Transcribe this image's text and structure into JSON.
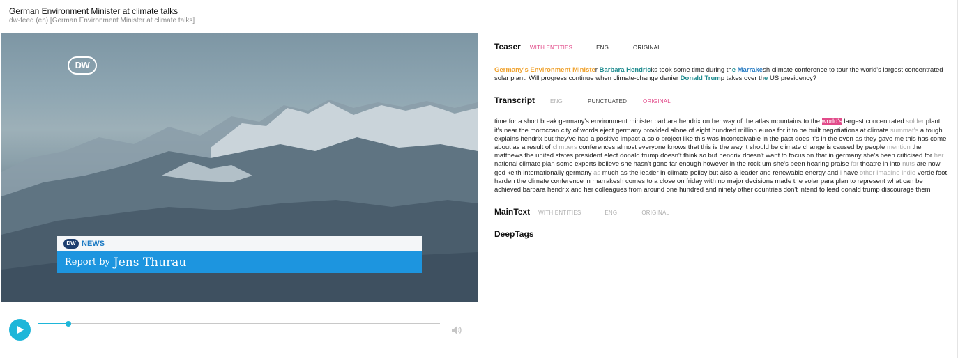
{
  "header": {
    "title": "German Environment Minister at climate talks",
    "subtitle": "dw-feed (en) [German Environment Minister at climate talks]"
  },
  "video": {
    "logo": "DW",
    "lower_third": {
      "badge": "DW",
      "label": "NEWS",
      "prefix": "Report by",
      "name": "Jens Thurau"
    }
  },
  "player": {
    "progress_fraction": 0.075,
    "icons": {
      "play": "play-icon",
      "volume": "volume-icon"
    },
    "accent_color": "#1eb6d9"
  },
  "teaser": {
    "title": "Teaser",
    "tabs": [
      {
        "label": "WITH ENTITIES",
        "active": true
      },
      {
        "label": "ENG",
        "active": false
      },
      {
        "label": "ORIGINAL",
        "active": false
      }
    ],
    "segments": [
      {
        "text": "Germany's Environment Ministe",
        "style": "ent-orange"
      },
      {
        "text": "r ",
        "style": ""
      },
      {
        "text": "Barbara Hendric",
        "style": "ent-teal"
      },
      {
        "text": "ks took some time during th",
        "style": ""
      },
      {
        "text": "e ",
        "style": "ent-teal"
      },
      {
        "text": "Marrake",
        "style": "ent-blue"
      },
      {
        "text": "sh climate conference to tour the world's largest concentrated solar plant. Will progress continue when climate-change denier ",
        "style": ""
      },
      {
        "text": "Donald Trum",
        "style": "ent-teal"
      },
      {
        "text": "p takes over th",
        "style": ""
      },
      {
        "text": "e ",
        "style": "ent-teal"
      },
      {
        "text": "US presidency?",
        "style": ""
      }
    ]
  },
  "transcript": {
    "title": "Transcript",
    "tabs": [
      {
        "label": "ENG",
        "active": false,
        "muted": true
      },
      {
        "label": "PUNCTUATED",
        "active": false,
        "muted": false
      },
      {
        "label": "ORIGINAL",
        "active": true,
        "muted": false
      }
    ],
    "segments": [
      {
        "text": "time for a short break germany's environment minister barbara hendrix on her way of the atlas mountains to the ",
        "style": ""
      },
      {
        "text": "world's",
        "style": "hl"
      },
      {
        "text": " largest concentrated ",
        "style": ""
      },
      {
        "text": "solder",
        "style": "dim"
      },
      {
        "text": " plant it's near the moroccan city of words eject germany provided alone of eight hundred million euros for it to be built negotiations at climate ",
        "style": ""
      },
      {
        "text": "summat's",
        "style": "dim"
      },
      {
        "text": " a tough explains hendrix but they've had a positive impact a solo project like this was inconceivable in the past does it's in the oven as they gave me this has come about as a result of ",
        "style": ""
      },
      {
        "text": "climbers",
        "style": "dim"
      },
      {
        "text": " conferences almost everyone knows that this is the way it should be climate change is caused by people ",
        "style": ""
      },
      {
        "text": "mention",
        "style": "dim"
      },
      {
        "text": " the matthews the united states president elect donald trump doesn't think so but hendrix doesn't want to focus on that in germany she's been criticised for ",
        "style": ""
      },
      {
        "text": "her",
        "style": "dim"
      },
      {
        "text": " national climate plan some experts believe she hasn't gone far enough however in the rock um she's been hearing praise ",
        "style": ""
      },
      {
        "text": "for",
        "style": "dim"
      },
      {
        "text": " theatre in into ",
        "style": ""
      },
      {
        "text": "nuts",
        "style": "dim"
      },
      {
        "text": " are now god keith internationally germany ",
        "style": ""
      },
      {
        "text": "as",
        "style": "dim"
      },
      {
        "text": " much as the leader in climate policy but also a leader and renewable energy and ",
        "style": ""
      },
      {
        "text": "i",
        "style": "dim"
      },
      {
        "text": " have ",
        "style": ""
      },
      {
        "text": "other",
        "style": "dim"
      },
      {
        "text": " ",
        "style": ""
      },
      {
        "text": "imagine indie",
        "style": "dim"
      },
      {
        "text": " verde foot harden the climate conference in marrakesh comes to a close on friday with no major decisions made the solar para plan to represent what can be achieved barbara hendrix and her colleagues from around one hundred and ninety other countries don't intend to lead donald trump discourage them",
        "style": ""
      }
    ]
  },
  "maintext": {
    "title": "MainText",
    "tabs": [
      {
        "label": "WITH ENTITIES",
        "active": false
      },
      {
        "label": "ENG",
        "active": false
      },
      {
        "label": "ORIGINAL",
        "active": false
      }
    ]
  },
  "deeptags": {
    "title": "DeepTags"
  },
  "colors": {
    "accent_pink": "#e24b8a",
    "muted_tab": "#b0b0b0",
    "inactive_tab": "#444444"
  }
}
